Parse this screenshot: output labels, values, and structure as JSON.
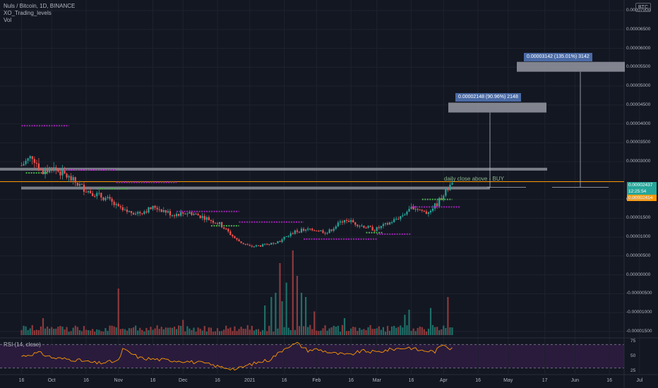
{
  "header": {
    "symbol_line": "Nuls / Bitcoin, 1D, BINANCE",
    "indicator_1": "XO_Trading_levels",
    "indicator_2": "Vol",
    "rsi_label": "RSI (14, close)",
    "currency_badge": "BTC"
  },
  "price_tags": {
    "last_price": "0.00002437",
    "countdown": "12:25:54",
    "level_price": "0.00002414"
  },
  "targets": [
    {
      "text": "0.00002148 (90.96%) 2148",
      "price": 4.45e-05
    },
    {
      "text": "0.00003142 (135.01%) 3142",
      "price": 5.53e-05
    }
  ],
  "annotation": {
    "text": "daily close above - BUY"
  },
  "colors": {
    "background": "#131722",
    "up": "#26a69a",
    "down": "#ef5350",
    "vol_up": "#1f6f68",
    "vol_down": "#8c3a3c",
    "rsi_line": "#ff9800",
    "rsi_band": "#2a1b3d",
    "orange_level": "#ff9800",
    "level_box": "#9598a1",
    "xo_purple": "#9c27b0",
    "xo_green": "#4caf50"
  },
  "chart_data": {
    "type": "candlestick",
    "title": "Nuls / Bitcoin, 1D, BINANCE",
    "y_axis": {
      "ticks": [
        "0.00007000",
        "0.00006500",
        "0.00006000",
        "0.00005500",
        "0.00005000",
        "0.00004500",
        "0.00004000",
        "0.00003500",
        "0.00003000",
        "0.00002500",
        "0.00002000",
        "0.00001500",
        "0.00001000",
        "0.00000500",
        "0.00000000",
        "-0.00000500",
        "-0.00001000",
        "-0.00001500"
      ],
      "tick_values": [
        7e-05,
        6.5e-05,
        6e-05,
        5.5e-05,
        5e-05,
        4.5e-05,
        4e-05,
        3.5e-05,
        3e-05,
        2.5e-05,
        2e-05,
        1.5e-05,
        1e-05,
        5e-06,
        0,
        -5e-06,
        -1e-05,
        -1.5e-05
      ],
      "ylim": [
        -1.65e-05,
        7.28e-05
      ]
    },
    "x_axis": {
      "ticks": [
        "16",
        "Oct",
        "16",
        "Nov",
        "16",
        "Dec",
        "16",
        "2021",
        "16",
        "Feb",
        "16",
        "Mar",
        "16",
        "Apr",
        "16",
        "May",
        "17",
        "Jun",
        "16",
        "Jul"
      ],
      "tick_days": [
        0,
        14,
        30,
        45,
        61,
        75,
        91,
        106,
        122,
        137,
        153,
        165,
        181,
        196,
        212,
        226,
        243,
        257,
        273,
        287
      ]
    },
    "close_anchors": [
      [
        0,
        2.9e-05
      ],
      [
        5,
        3.15e-05
      ],
      [
        10,
        2.7e-05
      ],
      [
        14,
        2.85e-05
      ],
      [
        20,
        2.65e-05
      ],
      [
        30,
        2.25e-05
      ],
      [
        40,
        2e-05
      ],
      [
        47,
        1.68e-05
      ],
      [
        55,
        1.65e-05
      ],
      [
        62,
        1.8e-05
      ],
      [
        70,
        1.6e-05
      ],
      [
        78,
        1.65e-05
      ],
      [
        85,
        1.52e-05
      ],
      [
        92,
        1.35e-05
      ],
      [
        100,
        9.2e-06
      ],
      [
        106,
        7.5e-06
      ],
      [
        112,
        7.8e-06
      ],
      [
        120,
        9e-06
      ],
      [
        127,
        1.15e-05
      ],
      [
        135,
        1.22e-05
      ],
      [
        142,
        1.12e-05
      ],
      [
        150,
        1.48e-05
      ],
      [
        157,
        1.32e-05
      ],
      [
        164,
        1.2e-05
      ],
      [
        170,
        1.35e-05
      ],
      [
        176,
        1.55e-05
      ],
      [
        182,
        1.8e-05
      ],
      [
        188,
        1.65e-05
      ],
      [
        193,
        1.88e-05
      ],
      [
        196,
        2.15e-05
      ],
      [
        200,
        2.43e-05
      ]
    ],
    "last_close": 2.437e-05,
    "levels": {
      "upper_box": 2.8e-05,
      "lower_box": 2.3e-05,
      "orange_line": 2.47e-05
    },
    "xo_purple_levels": [
      {
        "from": 0,
        "to": 22,
        "price": 3.95e-05
      },
      {
        "from": 20,
        "to": 44,
        "price": 2.78e-05
      },
      {
        "from": 44,
        "to": 72,
        "price": 2.45e-05
      },
      {
        "from": 72,
        "to": 101,
        "price": 1.68e-05
      },
      {
        "from": 101,
        "to": 131,
        "price": 1.4e-05
      },
      {
        "from": 131,
        "to": 165,
        "price": 9.5e-06
      },
      {
        "from": 165,
        "to": 181,
        "price": 1.08e-05
      },
      {
        "from": 181,
        "to": 204,
        "price": 1.8e-05
      }
    ],
    "volume": {
      "max_display": 1.0,
      "spikes": [
        [
          10,
          0.2
        ],
        [
          45,
          0.55
        ],
        [
          75,
          0.18
        ],
        [
          113,
          0.35
        ],
        [
          116,
          0.45
        ],
        [
          118,
          0.5
        ],
        [
          120,
          0.85
        ],
        [
          121,
          0.4
        ],
        [
          123,
          0.62
        ],
        [
          126,
          1.0
        ],
        [
          128,
          0.7
        ],
        [
          130,
          0.5
        ],
        [
          132,
          0.45
        ],
        [
          136,
          0.28
        ],
        [
          150,
          0.2
        ],
        [
          178,
          0.24
        ],
        [
          180,
          0.3
        ],
        [
          190,
          0.32
        ],
        [
          198,
          0.45
        ],
        [
          201,
          0.36
        ]
      ]
    },
    "rsi": {
      "upper_band": 70,
      "lower_band": 30,
      "ticks": [
        "75",
        "50",
        "25"
      ],
      "anchors": [
        [
          0,
          50
        ],
        [
          8,
          56
        ],
        [
          15,
          47
        ],
        [
          25,
          44
        ],
        [
          35,
          38
        ],
        [
          45,
          42
        ],
        [
          47,
          62
        ],
        [
          55,
          47
        ],
        [
          65,
          44
        ],
        [
          75,
          42
        ],
        [
          85,
          38
        ],
        [
          92,
          32
        ],
        [
          100,
          28
        ],
        [
          106,
          36
        ],
        [
          115,
          44
        ],
        [
          120,
          57
        ],
        [
          123,
          66
        ],
        [
          128,
          72
        ],
        [
          133,
          60
        ],
        [
          137,
          62
        ],
        [
          145,
          55
        ],
        [
          152,
          52
        ],
        [
          158,
          59
        ],
        [
          165,
          57
        ],
        [
          172,
          62
        ],
        [
          180,
          65
        ],
        [
          185,
          60
        ],
        [
          192,
          58
        ],
        [
          196,
          71
        ],
        [
          199,
          64
        ],
        [
          202,
          68
        ]
      ]
    }
  }
}
